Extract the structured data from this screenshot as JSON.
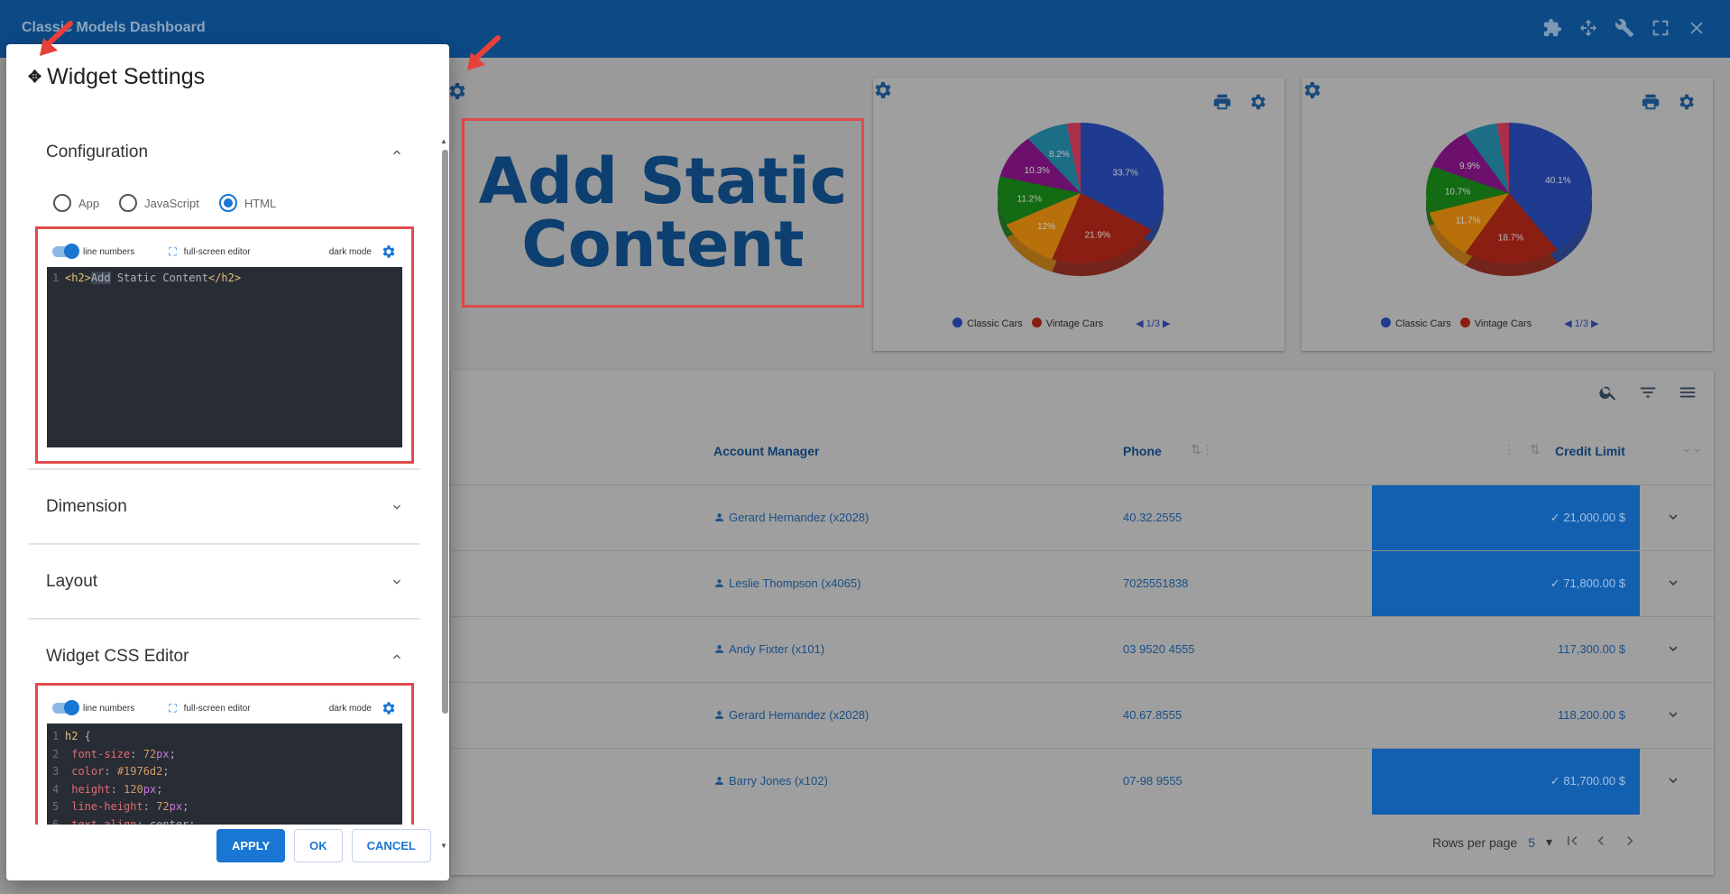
{
  "app": {
    "title": "Classic Models Dashboard"
  },
  "colors": {
    "accent": "#1976d2",
    "topbar": "#0c4a86",
    "annotation": "#e04b4b"
  },
  "static_widget": {
    "line1": "Add Static",
    "line2": "Content"
  },
  "charts": [
    {
      "type": "pie",
      "slices": [
        {
          "label": "33.7%",
          "value": 33.7,
          "color": "#1f3b8f"
        },
        {
          "label": "21.9%",
          "value": 21.9,
          "color": "#8a1e12"
        },
        {
          "label": "12%",
          "value": 12.0,
          "color": "#b8700a"
        },
        {
          "label": "11.2%",
          "value": 11.2,
          "color": "#136b13"
        },
        {
          "label": "10.3%",
          "value": 10.3,
          "color": "#6d0f6d"
        },
        {
          "label": "8.2%",
          "value": 8.2,
          "color": "#1b6e86"
        },
        {
          "label": "",
          "value": 2.7,
          "color": "#a8304a"
        }
      ],
      "legend": [
        "Classic Cars",
        "Vintage Cars"
      ],
      "pager": "1/3"
    },
    {
      "type": "pie",
      "slices": [
        {
          "label": "40.1%",
          "value": 40.1,
          "color": "#1f3b8f"
        },
        {
          "label": "18.7%",
          "value": 18.7,
          "color": "#8a1e12"
        },
        {
          "label": "11.7%",
          "value": 11.7,
          "color": "#b8700a"
        },
        {
          "label": "10.7%",
          "value": 10.7,
          "color": "#136b13"
        },
        {
          "label": "9.9%",
          "value": 9.9,
          "color": "#6d0f6d"
        },
        {
          "label": "",
          "value": 6.5,
          "color": "#1b6e86"
        },
        {
          "label": "",
          "value": 2.4,
          "color": "#a8304a"
        }
      ],
      "legend": [
        "Classic Cars",
        "Vintage Cars"
      ],
      "pager": "1/3"
    }
  ],
  "table": {
    "headers": {
      "manager": "Account Manager",
      "phone": "Phone",
      "credit": "Credit Limit"
    },
    "rows": [
      {
        "manager": "Gerard Hernandez (x2028)",
        "phone": "40.32.2555",
        "credit": "21,000.00 $",
        "highlight": true
      },
      {
        "manager": "Leslie Thompson (x4065)",
        "phone": "7025551838",
        "credit": "71,800.00 $",
        "highlight": true
      },
      {
        "manager": "Andy Fixter (x101)",
        "phone": "03 9520 4555",
        "credit": "117,300.00 $",
        "highlight": false
      },
      {
        "manager": "Gerard Hernandez (x2028)",
        "phone": "40.67.8555",
        "credit": "118,200.00 $",
        "highlight": false
      },
      {
        "manager": "Barry Jones (x102)",
        "phone": "07-98 9555",
        "credit": "81,700.00 $",
        "highlight": true
      }
    ],
    "footer": {
      "rows_per_page_label": "Rows per page",
      "rows_per_page": "5"
    }
  },
  "dialog": {
    "title": "Widget Settings",
    "sections": {
      "configuration": "Configuration",
      "dimension": "Dimension",
      "layout": "Layout",
      "css_editor": "Widget CSS Editor"
    },
    "radios": {
      "app": "App",
      "javascript": "JavaScript",
      "html": "HTML"
    },
    "editor_bar": {
      "line_numbers": "line numbers",
      "full_screen": "full-screen editor",
      "dark_mode": "dark mode"
    },
    "buttons": {
      "apply": "APPLY",
      "ok": "OK",
      "cancel": "CANCEL"
    }
  }
}
